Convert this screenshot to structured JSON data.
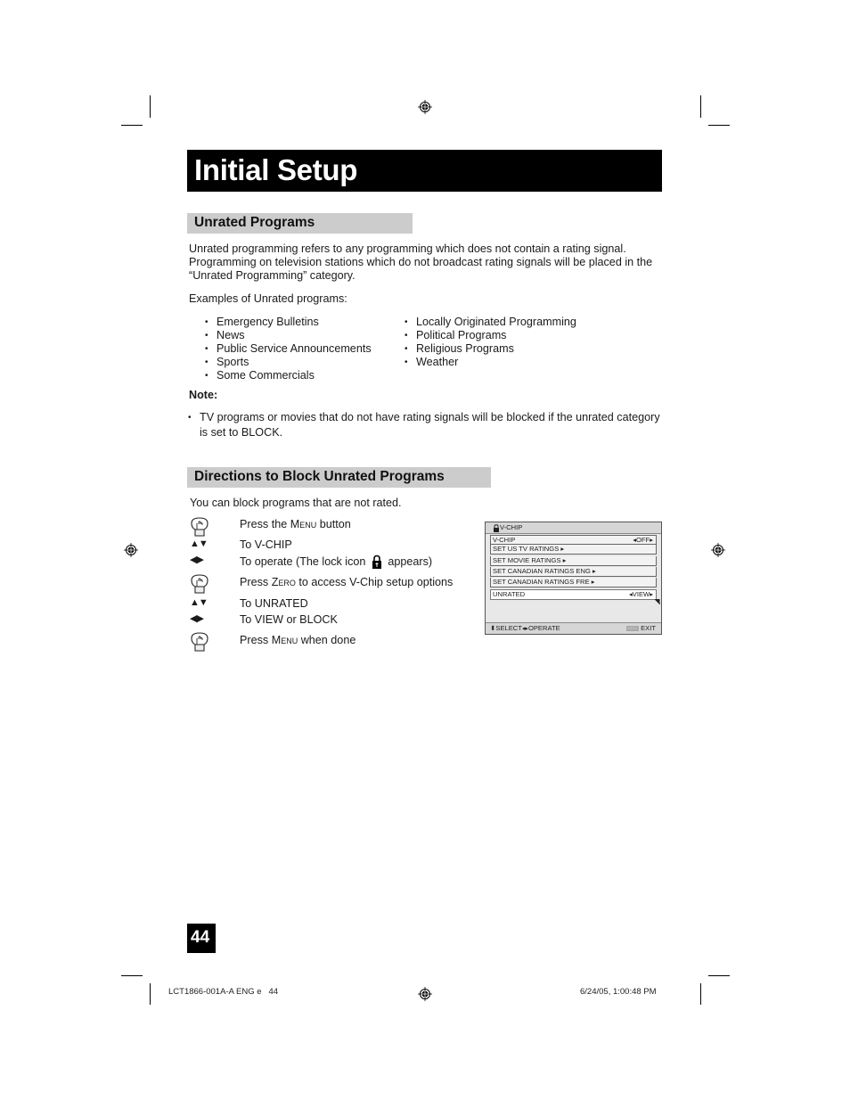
{
  "header": {
    "title": "Initial Setup"
  },
  "unrated_section": {
    "heading": "Unrated Programs",
    "intro_lines": [
      "Unrated programming refers to any programming which does not contain a rating signal.",
      "Programming on television stations which do not broadcast rating signals will be placed in the",
      "“Unrated Programming” category."
    ],
    "examples_label": "Examples of Unrated programs:",
    "examples_left": [
      "Emergency Bulletins",
      "News",
      "Public Service Announcements",
      "Sports",
      "Some Commercials"
    ],
    "examples_right": [
      "Locally Originated Programming",
      "Political Programs",
      "Religious Programs",
      "Weather"
    ],
    "note_label": "Note:",
    "note_lines": [
      "TV programs or movies that do not have rating signals will be blocked if the unrated category",
      "is set to BLOCK."
    ]
  },
  "directions_section": {
    "heading": "Directions to Block Unrated Programs",
    "intro": "You can block programs that are not rated.",
    "steps": [
      {
        "icon": "hand-press-icon",
        "prefix": "Press the ",
        "key": "Menu",
        "suffix": " button"
      },
      {
        "icon": "up-down-arrows-icon",
        "text": "To V-CHIP"
      },
      {
        "icon": "left-right-arrows-icon",
        "prefix": "To operate (The lock icon ",
        "suffix": " appears)"
      },
      {
        "icon": "hand-press-icon",
        "prefix": "Press ",
        "key": "Zero",
        "suffix": " to access V-Chip setup options"
      },
      {
        "icon": "up-down-arrows-icon",
        "text": "To UNRATED"
      },
      {
        "icon": "left-right-arrows-icon",
        "text": "To VIEW or BLOCK"
      },
      {
        "icon": "hand-press-icon",
        "prefix": "Press ",
        "key": "Menu",
        "suffix": " when done"
      }
    ]
  },
  "osd_menu": {
    "title": "V-CHIP",
    "rows": [
      {
        "label": "V-CHIP",
        "value": "OFF"
      },
      {
        "label": "SET US TV RATINGS"
      },
      {
        "label": "SET MOVIE RATINGS"
      },
      {
        "label": "SET CANADIAN RATINGS ENG"
      },
      {
        "label": "SET CANADIAN RATINGS FRE"
      },
      {
        "label": "UNRATED",
        "value": "VIEW",
        "selected": true
      }
    ],
    "footer_select": "SELECT",
    "footer_operate": "OPERATE",
    "footer_menu_key": "MENU",
    "footer_exit": "EXIT"
  },
  "page_number": "44",
  "print_footer": {
    "left": "LCT1866-001A-A ENG e   44",
    "right": "6/24/05, 1:00:48 PM"
  }
}
